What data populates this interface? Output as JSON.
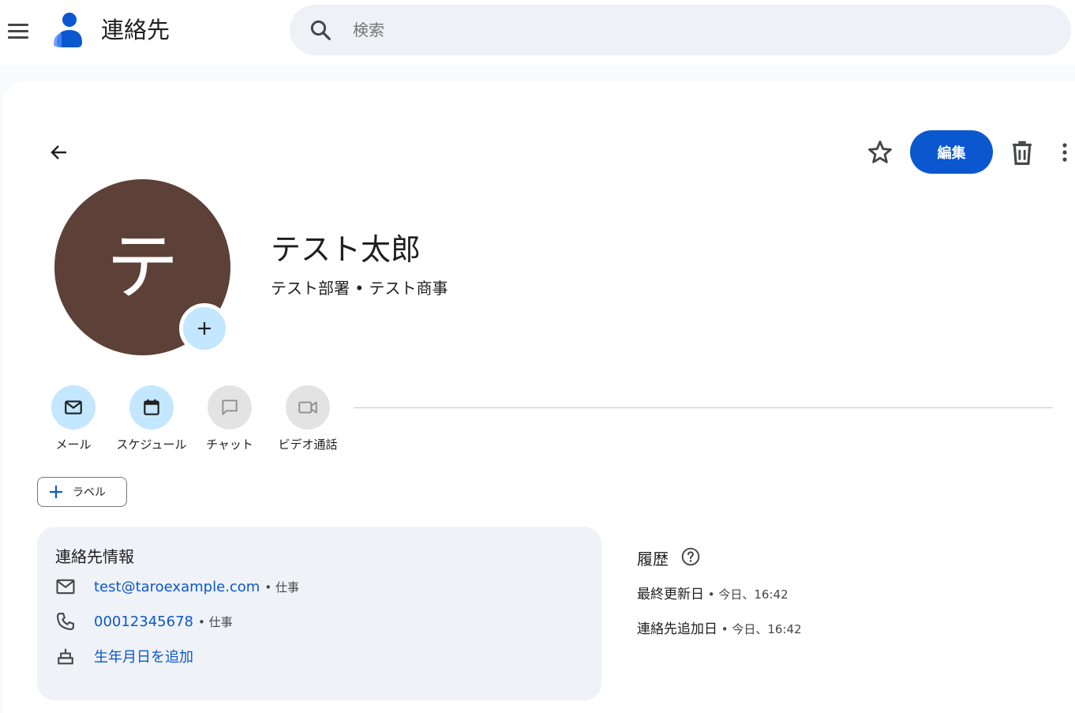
{
  "header": {
    "app_title": "連絡先",
    "search_placeholder": "検索",
    "menu_icon": "hamburger-menu-icon",
    "logo_icon": "contacts-logo-icon"
  },
  "toolbar": {
    "edit_label": "編集",
    "back_icon": "arrow-back-icon",
    "star_icon": "star-outline-icon",
    "delete_icon": "trash-icon",
    "more_icon": "more-vert-icon"
  },
  "contact": {
    "avatar_initial": "テ",
    "avatar_color": "#5d4037",
    "name": "テスト太郎",
    "subtitle": "テスト部署 • テスト商事"
  },
  "actions": [
    {
      "label": "メール",
      "icon": "mail-icon",
      "enabled": true
    },
    {
      "label": "スケジュール",
      "icon": "calendar-icon",
      "enabled": true
    },
    {
      "label": "チャット",
      "icon": "chat-icon",
      "enabled": false
    },
    {
      "label": "ビデオ通話",
      "icon": "video-call-icon",
      "enabled": false
    }
  ],
  "label_button": "ラベル",
  "info": {
    "title": "連絡先情報",
    "email": {
      "value": "test@taroexample.com",
      "meta": "• 仕事"
    },
    "phone": {
      "value": "00012345678",
      "meta": "• 仕事"
    },
    "birthday": {
      "value": "生年月日を追加"
    }
  },
  "history": {
    "title": "履歴",
    "rows": [
      {
        "label": "最終更新日",
        "meta": " • 今日、16:42"
      },
      {
        "label": "連絡先追加日",
        "meta": " • 今日、16:42"
      }
    ]
  },
  "colors": {
    "accent": "#0b57d0",
    "action_active_bg": "#c2e7ff",
    "action_disabled_bg": "#e3e3e3"
  }
}
